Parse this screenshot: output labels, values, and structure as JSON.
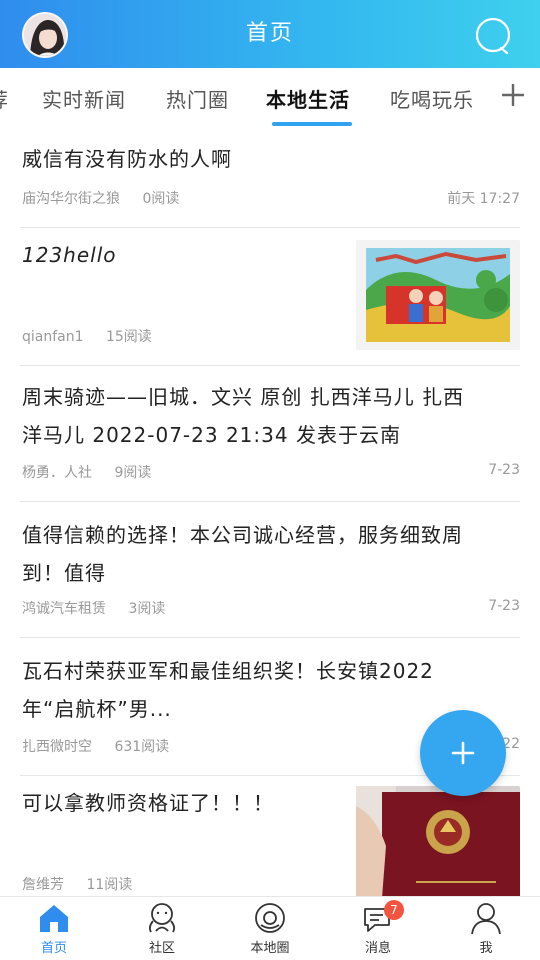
{
  "header": {
    "title": "首页"
  },
  "tabs": [
    {
      "label": "荐"
    },
    {
      "label": "实时新闻"
    },
    {
      "label": "热门圈"
    },
    {
      "label": "本地生活"
    },
    {
      "label": "吃喝玩乐"
    }
  ],
  "feed": [
    {
      "title_lines": [
        "威信有没有防水的人啊"
      ],
      "author": "庙沟华尔街之狼",
      "reads": "0阅读",
      "time": "前天 17:27"
    },
    {
      "title_lines": [
        "123hello"
      ],
      "author": "qianfan1",
      "reads": "15阅读",
      "time": "",
      "thumbnail": "children-drawing-image"
    },
    {
      "title_lines": [
        "周末骑迹——旧城．文兴  原创 扎西洋马儿  扎西",
        "洋马儿  2022-07-23 21:34 发表于云南"
      ],
      "author": "杨勇．人社",
      "reads": "9阅读",
      "time": "7-23"
    },
    {
      "title_lines": [
        "值得信赖的选择！本公司诚心经营，服务细致周",
        "到！值得"
      ],
      "author": "鸿诚汽车租赁",
      "reads": "3阅读",
      "time": "7-23"
    },
    {
      "title_lines": [
        "瓦石村荣获亚军和最佳组织奖！长安镇2022",
        "年“启航杯”男..."
      ],
      "author": "扎西微时空",
      "reads": "631阅读",
      "time": "22"
    },
    {
      "title_lines": [
        "可以拿教师资格证了！！！"
      ],
      "author": "詹维芳",
      "reads": "11阅读",
      "time": "",
      "thumbnail": "certificate-image"
    }
  ],
  "bottom_nav": [
    {
      "label": "首页",
      "icon": "home-icon",
      "active": true
    },
    {
      "label": "社区",
      "icon": "community-icon"
    },
    {
      "label": "本地圈",
      "icon": "local-circle-icon"
    },
    {
      "label": "消息",
      "icon": "message-icon",
      "badge": "7"
    },
    {
      "label": "我",
      "icon": "profile-icon"
    }
  ],
  "colors": {
    "accent": "#2f8dee",
    "header_gradient_end": "#3ed0ee",
    "badge": "#f2543f"
  }
}
